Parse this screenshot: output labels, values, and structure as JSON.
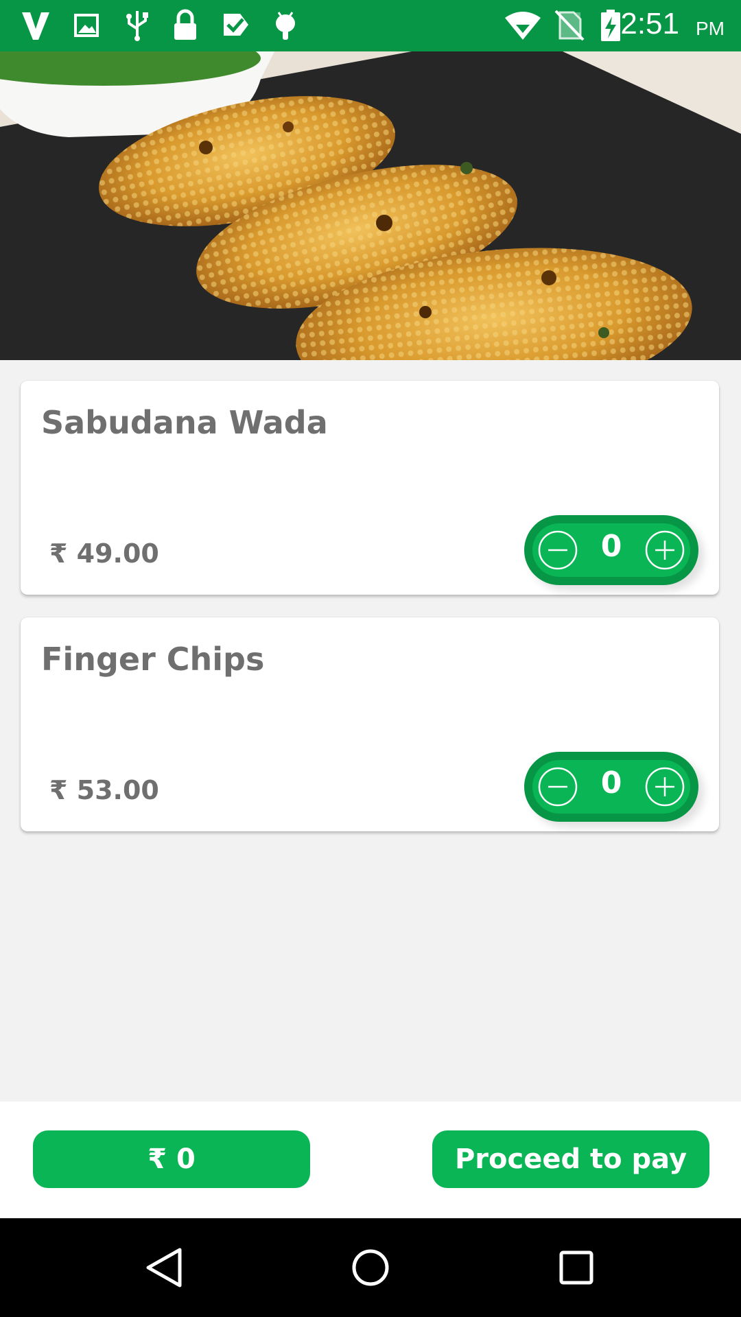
{
  "status_bar": {
    "time": "2:51",
    "ampm": "PM",
    "left_icons": [
      "vodafone-icon",
      "gallery-icon",
      "usb-icon",
      "lock-icon",
      "task-icon",
      "android-icon"
    ],
    "right_icons": [
      "wifi-icon",
      "no-sim-icon",
      "battery-charging-icon"
    ],
    "background": "#079646"
  },
  "hero": {
    "image": "fried-snack-photo"
  },
  "items": [
    {
      "name": "Sabudana Wada",
      "price": "₹ 49.00",
      "quantity": "0"
    },
    {
      "name": "Finger Chips",
      "price": "₹ 53.00",
      "quantity": "0"
    }
  ],
  "bottom_bar": {
    "total_label": "₹ 0",
    "proceed_label": "Proceed to pay"
  },
  "colors": {
    "accent_green": "#0ab555",
    "dark_green": "#079646",
    "text_gray": "#6f6f6f",
    "background": "#f2f2f2"
  },
  "nav_bar": {
    "buttons": [
      "back-icon",
      "home-icon",
      "recents-icon"
    ]
  }
}
